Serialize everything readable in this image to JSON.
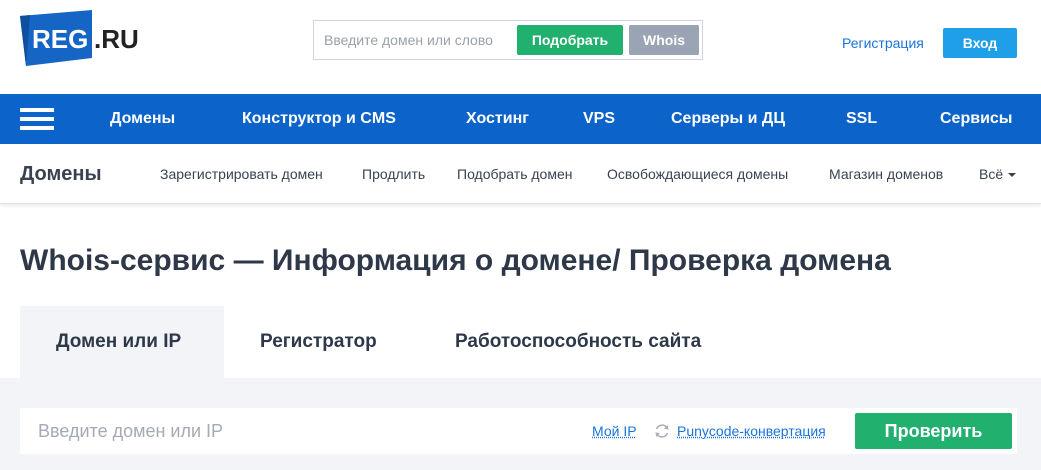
{
  "header": {
    "logo_main": "REG",
    "logo_suffix": ".RU",
    "search_placeholder": "Введите домен или слово",
    "pick_label": "Подобрать",
    "whois_label": "Whois",
    "register_label": "Регистрация",
    "login_label": "Вход",
    "brand_color": "#1566c4"
  },
  "main_nav": {
    "items": [
      "Домены",
      "Конструктор и CMS",
      "Хостинг",
      "VPS",
      "Серверы и ДЦ",
      "SSL",
      "Сервисы"
    ],
    "background": "#0c63c9"
  },
  "sub_nav": {
    "title": "Домены",
    "items": [
      "Зарегистрировать домен",
      "Продлить",
      "Подобрать домен",
      "Освобождающиеся домены",
      "Магазин доменов",
      "Всё"
    ]
  },
  "page": {
    "title": "Whois-сервис — Информация о домене/ Проверка домена"
  },
  "tabs": [
    {
      "label": "Домен или IP",
      "active": true
    },
    {
      "label": "Регистратор",
      "active": false
    },
    {
      "label": "Работоспособность сайта",
      "active": false
    }
  ],
  "search_panel": {
    "placeholder": "Введите домен или IP",
    "my_ip_label": "Мой IP",
    "punycode_label": "Punycode-конвертация",
    "check_label": "Проверить",
    "accent": "#21b06e"
  }
}
